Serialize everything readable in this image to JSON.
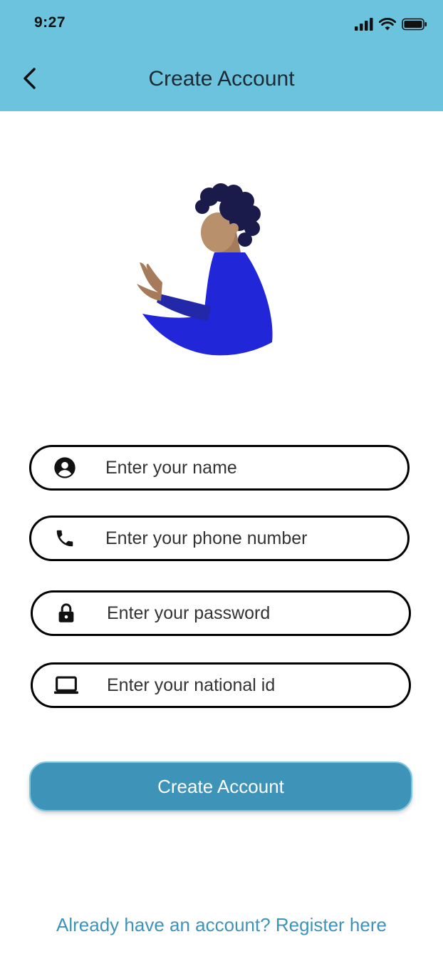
{
  "status_bar": {
    "time": "9:27"
  },
  "header": {
    "title": "Create Account",
    "background": "#6bc3dd"
  },
  "form": {
    "name_placeholder": "Enter your name",
    "phone_placeholder": "Enter your phone number",
    "password_placeholder": "Enter your password",
    "national_id_placeholder": "Enter your national id",
    "icons": [
      "account-circle-icon",
      "phone-icon",
      "lock-icon",
      "laptop-icon"
    ]
  },
  "actions": {
    "create_label": "Create Account",
    "register_link": "Already have an account? Register here",
    "accent": "#3e93b8"
  }
}
